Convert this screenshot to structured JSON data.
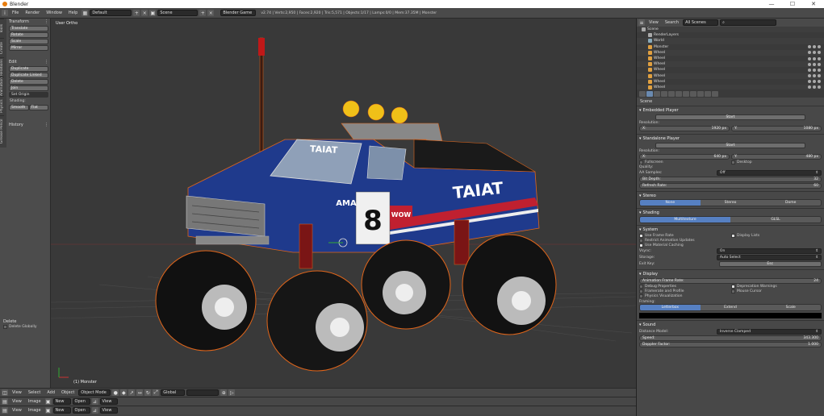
{
  "window": {
    "title": "Blender",
    "minimize": "—",
    "maximize": "☐",
    "close": "✕"
  },
  "infobar": {
    "menus": [
      "File",
      "Render",
      "Window",
      "Help"
    ],
    "layout": "Default",
    "scene": "Scene",
    "engine": "Blender Game",
    "stats": "v2.74 | Verts:2,950 | Faces:2,920 | Tris:5,571 | Objects:1/17 | Lamps:0/0 | Mem:37.35M | Monster"
  },
  "toolshelf": {
    "tabs": [
      "Tools",
      "Create",
      "Relations",
      "Animation",
      "Physics",
      "Grease Pencil"
    ],
    "transform_head": "Transform",
    "transform_buttons": [
      "Translate",
      "Rotate",
      "Scale",
      "Mirror"
    ],
    "edit_head": "Edit",
    "edit_buttons": [
      "Duplicate",
      "Duplicate Linked",
      "Delete",
      "Join"
    ],
    "set_origin": "Set Origin",
    "shading_label": "Shading:",
    "smooth": "Smooth",
    "flat": "Flat",
    "history_head": "History",
    "op_head": "Delete",
    "delete_globally": "Delete Globally"
  },
  "viewport": {
    "label": "User Ortho",
    "object": "(1) Monster",
    "truck_text": "TAIAT",
    "number": "8",
    "wow": "WOW",
    "ama": "AMA"
  },
  "bottom": {
    "bar1": {
      "menus": [
        "View",
        "Select",
        "Add",
        "Object"
      ],
      "mode": "Object Mode",
      "pivot": "Global"
    },
    "bar2": {
      "menus": [
        "View",
        "Image"
      ],
      "new": "New",
      "open": "Open",
      "view": "View"
    },
    "bar3": {
      "menus": [
        "View",
        "Image"
      ],
      "new": "New",
      "open": "Open",
      "view": "View"
    }
  },
  "outliner": {
    "menus": [
      "View",
      "Search"
    ],
    "filter": "All Scenes",
    "rows": [
      "Scene",
      "RenderLayers",
      "World",
      "Monster",
      "Wheel",
      "Wheel",
      "Wheel",
      "Wheel",
      "Wheel",
      "Wheel",
      "Wheel"
    ]
  },
  "properties": {
    "breadcrumb": "Scene",
    "embedded": {
      "head": "Embedded Player",
      "start": "Start",
      "res_label": "Resolution:",
      "x": "X:",
      "xv": "1920 px",
      "y": "Y:",
      "yv": "1080 px"
    },
    "standalone": {
      "head": "Standalone Player",
      "start": "Start",
      "res_label": "Resolution:",
      "x": "X:",
      "xv": "640 px",
      "y": "Y:",
      "yv": "480 px",
      "fullscreen": "Fullscreen",
      "desktop": "Desktop",
      "quality": "Quality:",
      "aa": "AA Samples:",
      "aav": "Off",
      "bit": "Bit Depth:",
      "bitv": "32",
      "refresh": "Refresh Rate:",
      "refreshv": "60"
    },
    "stereo": {
      "head": "Stereo",
      "opts": [
        "None",
        "Stereo",
        "Dome"
      ]
    },
    "shading": {
      "head": "Shading",
      "opts": [
        "Multitexture",
        "GLSL"
      ]
    },
    "system": {
      "head": "System",
      "frame_rate": "Use Frame Rate",
      "display_lists": "Display Lists",
      "restrict": "Restrict Animation Updates",
      "material_cache": "Use Material Caching",
      "vsync": "Vsync:",
      "vsyncv": "On",
      "storage": "Storage:",
      "storagev": "Auto Select",
      "exit": "Exit Key:",
      "exitv": "Esc"
    },
    "display": {
      "head": "Display",
      "fps": "Animation Frame Rate:",
      "fpsv": "24",
      "debug": "Debug Properties",
      "deprecation": "Deprecation Warnings",
      "framerate": "Framerate and Profile",
      "mouse": "Mouse Cursor",
      "physics": "Physics Visualization",
      "framing": "Framing:",
      "framing_opts": [
        "Letterbox",
        "Extend",
        "Scale"
      ]
    },
    "sound": {
      "head": "Sound",
      "distance": "Distance Model:",
      "distancev": "Inverse Clamped",
      "speed": "Speed:",
      "speedv": "343.300",
      "doppler": "Doppler Factor:",
      "dopplerv": "1.000"
    }
  }
}
